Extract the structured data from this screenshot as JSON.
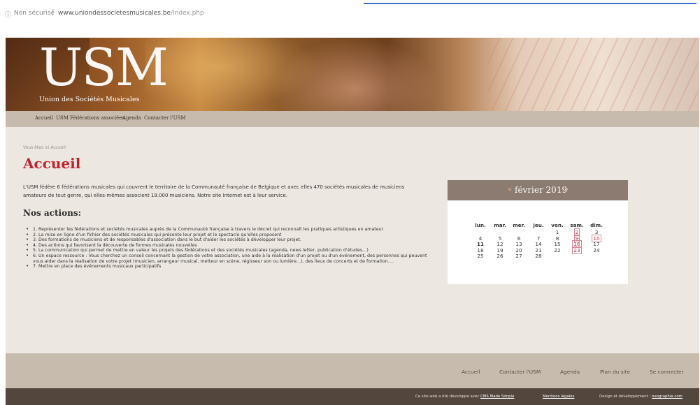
{
  "browser": {
    "info_icon": "ⓘ",
    "security_text": "Non sécurisé",
    "separator": "|",
    "url_host": "www.uniondessocietesmusicales.be",
    "url_path": "/index.php"
  },
  "banner": {
    "logo_text": "USM",
    "tagline": "Union des Sociétés Musicales"
  },
  "nav": {
    "items": [
      "Accueil",
      "USM",
      "Fédérations associées",
      "Agenda",
      "Contacter l'USM"
    ]
  },
  "main": {
    "breadcrumb": "Vous êtes ici Accueil",
    "title": "Accueil",
    "intro": "L'USM fédère 6 fédérations musicales qui couvrent le territoire de la Communauté française de Belgique et avec elles 470 sociétés musicales de musiciens amateurs de tout genre, qui elles-mêmes associent 19.000 musiciens. Notre site Internet est à leur service.",
    "actions_title": "Nos actions:",
    "actions": [
      "1. Représenter les fédérations et sociétés musicales auprès de la Communauté française à travers le décret qui reconnaît les pratiques artistiques en amateur",
      "2. La mise en ligne d'un fichier des sociétés musicales qui présente leur projet et le spectacle qu'elles proposent",
      "3. Des formations de musiciens et de responsables d'association dans le but d'aider les sociétés à développer leur projet.",
      "4. Des actions qui favorisent la découverte de formes musicales nouvelles",
      "5. La communication qui permet de mettre en valeur les projets des fédérations et des sociétés musicales (agenda, news letter, publication d'études…)",
      "6. Un espace ressource : Vous cherchez un conseil concernant la gestion de votre association, une aide à la réalisation d'un projet ou d'un événement, des personnes qui peuvent vous aider dans la réalisation de votre projet (musicien, arrangeur musical, metteur en scène, régisseur son ou lumière…), des lieux de concerts et de formation….",
      "7. Mettre en place des événements musicaux participatifs"
    ]
  },
  "calendar": {
    "prev": "«",
    "month": "février 2019",
    "next": "»",
    "weekdays": [
      "lun.",
      "mar.",
      "mer.",
      "jeu.",
      "ven.",
      "sam.",
      "dim."
    ],
    "weeks": [
      [
        "",
        "",
        "",
        "",
        "1",
        "2",
        "3"
      ],
      [
        "4",
        "5",
        "6",
        "7",
        "8",
        "9",
        "10"
      ],
      [
        "11",
        "12",
        "13",
        "14",
        "15",
        "16",
        "17"
      ],
      [
        "18",
        "19",
        "20",
        "21",
        "22",
        "23",
        "24"
      ],
      [
        "25",
        "26",
        "27",
        "28",
        "",
        "",
        ""
      ]
    ],
    "event_days": [
      "2",
      "9",
      "10",
      "16",
      "23"
    ],
    "today": "11"
  },
  "footer": {
    "links": [
      "Accueil",
      "Contacter l'USM",
      "Agenda",
      "Plan du site",
      "Se connecter"
    ],
    "credit_prefix": "Ce site web a été développé avec",
    "cms_link": "CMS Made Simple",
    "legal_link": "Mentions légales",
    "design_prefix": "Design et développement :",
    "design_link": "neographie.com"
  },
  "colors": {
    "title_red": "#c0222b",
    "nav_bg": "#c7bbae",
    "calendar_head": "#8b7b70",
    "bottom_bar": "#53463d"
  }
}
